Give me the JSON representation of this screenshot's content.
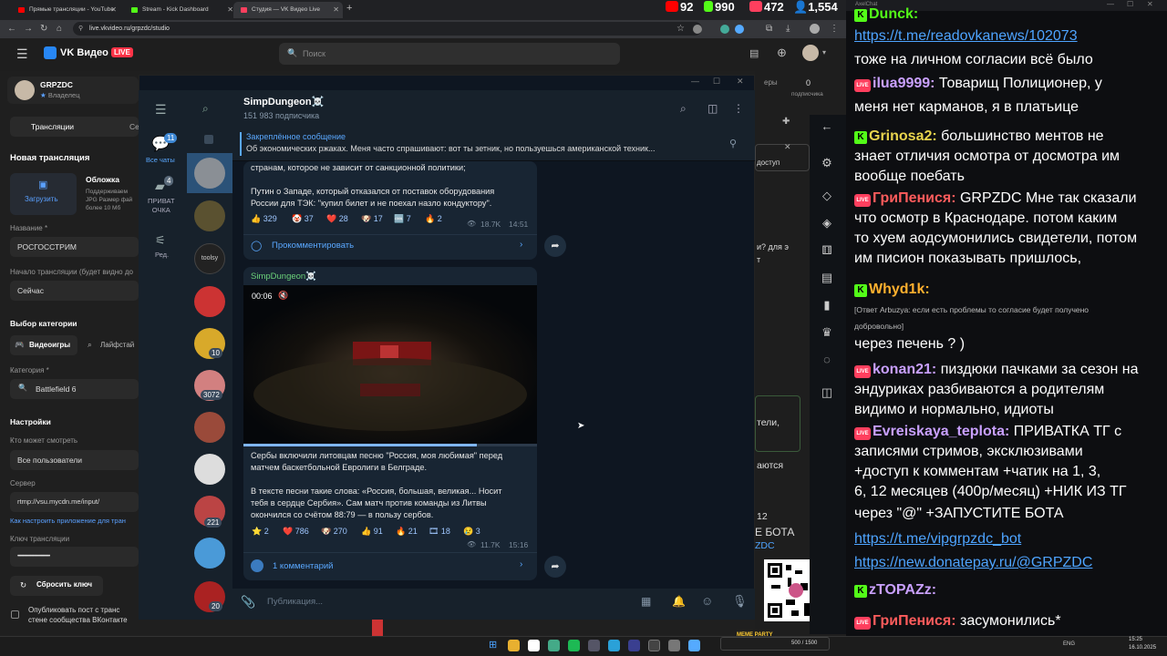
{
  "browser": {
    "tabs": [
      {
        "label": "Прямые трансляции - YouTube",
        "color": "#ff0000"
      },
      {
        "label": "Stream - Kick Dashboard",
        "color": "#53fc18"
      },
      {
        "label": "Студия — VK Видео Live",
        "color": "#ff3f5e"
      }
    ],
    "url": "live.vkvideo.ru/grpzdc/studio"
  },
  "stats": {
    "youtube": "92",
    "kick": "990",
    "vk": "472",
    "total": "1,554"
  },
  "vk": {
    "logo": "VK Видео",
    "live_badge": "LIVE",
    "search_placeholder": "Поиск",
    "channel_name": "GRPZDC",
    "channel_role": "Владелец",
    "subscribers": "0",
    "subscribers_label": "подписчика",
    "viewers_label": "еры",
    "tabs": [
      "Трансляции",
      "Се"
    ],
    "new_stream": "Новая трансляция",
    "upload": "Загрузить",
    "cover": "Обложка",
    "cover_hint": "Поддерживаем\nJPG Размер фай\nболее 10 Мб",
    "name_label": "Название *",
    "name_value": "РОСГОССТРИМ",
    "start_label": "Начало трансляции (будет видно до",
    "start_value": "Сейчас",
    "category_choice": "Выбор категории",
    "cat_games": "Видеоигры",
    "cat_life": "Лайфстай",
    "category_label": "Категория *",
    "category_value": "Battlefield 6",
    "settings": "Настройки",
    "who_label": "Кто может смотреть",
    "who_value": "Все пользователи",
    "server_label": "Сервер",
    "server_value": "rtmp://vsu.mycdn.me/input/",
    "setup_link": "Как настроить приложение для тран",
    "key_label": "Ключ трансляции",
    "key_value": "••••••••••••••••••••••••••••••••",
    "reset_key": "Сбросить ключ",
    "publish_post": "Опубликовать пост с транс\nстене сообщества ВКонтакте",
    "right_fragments": [
      "доступ",
      "и? для э",
      "т",
      "тели,",
      "аются",
      "12",
      "Е БОТА",
      "ZDC"
    ]
  },
  "telegram": {
    "channel_title": "SimpDungeon☠️",
    "channel_subs": "151 983 подписчика",
    "folders": [
      {
        "label": "Все чаты",
        "badge": "11"
      },
      {
        "label": "ПРИВАТ\nОЧКА",
        "badge": "4"
      },
      {
        "label": "Ред.",
        "badge": ""
      }
    ],
    "pinned_title": "Закреплённое сообщение",
    "pinned_text": "Об экономических ржаках.  Меня часто спрашивают: вот ты зетник, но пользуешься американской техник...",
    "post1": {
      "text1": "странам, которое не зависит от санкционной политики;",
      "text2": "Путин о Западе, который отказался от поставок оборудования\nРоссии для ТЭК: \"купил билет и не поехал назло кондуктору\".",
      "reactions": [
        "👍 329",
        "🤡 37",
        "❤️ 28",
        "🐶 17",
        "🆒 7",
        "🔥 2"
      ],
      "views": "18.7K",
      "time": "14:51",
      "comment": "Прокомментировать"
    },
    "post2": {
      "author": "SimpDungeon☠️",
      "video_time": "00:06",
      "text1": "Сербы включили литовцам песню \"Россия, моя любимая\" перед\nматчем баскетбольной Евролиги в Белграде.",
      "text2": "В тексте песни такие слова: «Россия, большая, великая... Носит\nтебя в сердце Сербия». Сам матч против команды из Литвы\nокончился со счётом 88:79 — в пользу сербов.",
      "reactions": [
        "⭐ 2",
        "❤️ 786",
        "🐶 270",
        "👍 91",
        "🔥 21",
        "🎞 18",
        "😢 3"
      ],
      "views": "11.7K",
      "time": "15:16",
      "comment": "1 комментарий"
    },
    "chat_badges": [
      "10",
      "3072",
      "221",
      "20"
    ],
    "composer_placeholder": "Публикация..."
  },
  "chat": {
    "title": "AxelChat",
    "lines": [
      {
        "t": "Dunck:",
        "kind": "kick"
      },
      {
        "t": "https://t.me/readovkanews/102073",
        "kind": "link"
      },
      {
        "t": "тоже на личном согласии всё было",
        "kind": "text"
      },
      {
        "t": "ilua9999:",
        "rest": " Товарищ Полиционер, у",
        "kind": "vk",
        "nameColor": "#c9a0ff"
      },
      {
        "t": "меня нет карманов, я в платьице",
        "kind": "text"
      },
      {
        "t": "Grinosa2:",
        "rest": " большинство ментов не",
        "kind": "kick",
        "nameColor": "#e8d44d"
      },
      {
        "t": "знает отличия осмотра от досмотра им",
        "kind": "text"
      },
      {
        "t": "вообще поебать",
        "kind": "text"
      },
      {
        "t": "ГриПенисᴙ:",
        "rest": " GRPZDC Мне так сказали",
        "kind": "vk",
        "nameColor": "#ff5c5c"
      },
      {
        "t": "что осмотр в Краснодаре. потом каким",
        "kind": "text"
      },
      {
        "t": "то хуем аодсумонились свидетели, потом",
        "kind": "text"
      },
      {
        "t": "им писион показывать пришлось,",
        "kind": "text"
      },
      {
        "t": "Whyd1k:",
        "kind": "kick",
        "nameColor": "#ffb02e"
      },
      {
        "t": "[Ответ Arbuzya: если есть проблемы то согласие будет получено",
        "kind": "small"
      },
      {
        "t": "добровольно]",
        "kind": "small"
      },
      {
        "t": "через печень ? )",
        "kind": "text"
      },
      {
        "t": "konan21:",
        "rest": " пиздюки пачками за сезон на",
        "kind": "vk",
        "nameColor": "#c9a0ff"
      },
      {
        "t": "эндуриках разбиваются а родителям",
        "kind": "text"
      },
      {
        "t": "видимо и нормально, идиоты",
        "kind": "text"
      },
      {
        "t": "Evreiskaya_teplota:",
        "rest": " ПРИВАТКА ТГ с",
        "kind": "vk",
        "nameColor": "#c9a0ff"
      },
      {
        "t": "записями стримов, эксклюзивами",
        "kind": "text"
      },
      {
        "t": "+доступ к комментам +чатик      на 1, 3,",
        "kind": "text"
      },
      {
        "t": "6, 12 месяцев (400р/месяц) +НИК ИЗ ТГ",
        "kind": "text"
      },
      {
        "t": "через \"@\" +ЗАПУСТИТЕ БОТА",
        "kind": "text"
      },
      {
        "t": "https://t.me/vipgrpzdc_bot",
        "kind": "link"
      },
      {
        "t": "https://new.donatepay.ru/@GRPZDC",
        "kind": "link"
      },
      {
        "t": "zTOPAZz:",
        "kind": "kick",
        "nameColor": "#c9a0ff"
      },
      {
        "t": "ГриПенисᴙ:",
        "rest": " засумонились*",
        "kind": "vk",
        "nameColor": "#ff5c5c"
      }
    ]
  },
  "taskbar": {
    "lang": "ENG",
    "time": "15:25",
    "date": "16.10.2025",
    "meme": "MEME PARTY",
    "meme_count": "500 / 1500"
  }
}
